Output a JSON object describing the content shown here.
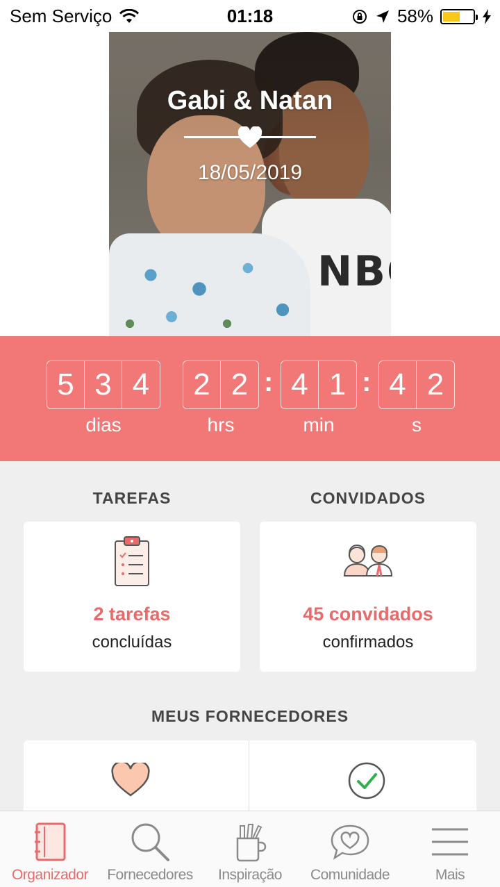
{
  "status_bar": {
    "carrier": "Sem Serviço",
    "time": "01:18",
    "battery_percent": "58%",
    "battery_level": 0.58,
    "icons": [
      "wifi-icon",
      "orientation-lock-icon",
      "location-arrow-icon",
      "battery-icon",
      "charging-bolt-icon"
    ]
  },
  "hero": {
    "couple_names": "Gabi & Natan",
    "wedding_date": "18/05/2019"
  },
  "countdown": {
    "days_digits": [
      "5",
      "3",
      "4"
    ],
    "hours_digits": [
      "2",
      "2"
    ],
    "minutes_digits": [
      "4",
      "1"
    ],
    "seconds_digits": [
      "4",
      "2"
    ],
    "separator": ":",
    "labels": {
      "days": "dias",
      "hours": "hrs",
      "minutes": "min",
      "seconds": "s"
    },
    "background_color": "#f27878"
  },
  "tasks": {
    "heading": "TAREFAS",
    "count_text": "2 tarefas",
    "sub_text": "concluídas",
    "icon": "clipboard-checklist-icon"
  },
  "guests": {
    "heading": "CONVIDADOS",
    "count_text": "45 convidados",
    "sub_text": "confirmados",
    "icon": "couple-guests-icon"
  },
  "suppliers": {
    "heading": "MEUS FORNECEDORES",
    "icons": [
      "heart-icon",
      "check-circle-icon"
    ]
  },
  "tabbar": {
    "active": "organizador",
    "items": [
      {
        "label": "Organizador",
        "icon": "notebook-icon"
      },
      {
        "label": "Fornecedores",
        "icon": "search-icon"
      },
      {
        "label": "Inspiração",
        "icon": "pencil-cup-icon"
      },
      {
        "label": "Comunidade",
        "icon": "chat-heart-icon"
      },
      {
        "label": "Mais",
        "icon": "menu-icon"
      }
    ]
  },
  "colors": {
    "accent": "#e96a6a",
    "countdown_bg": "#f27878",
    "page_bg": "#efefef",
    "battery": "#f8c71a",
    "check_green": "#2bb24c"
  }
}
